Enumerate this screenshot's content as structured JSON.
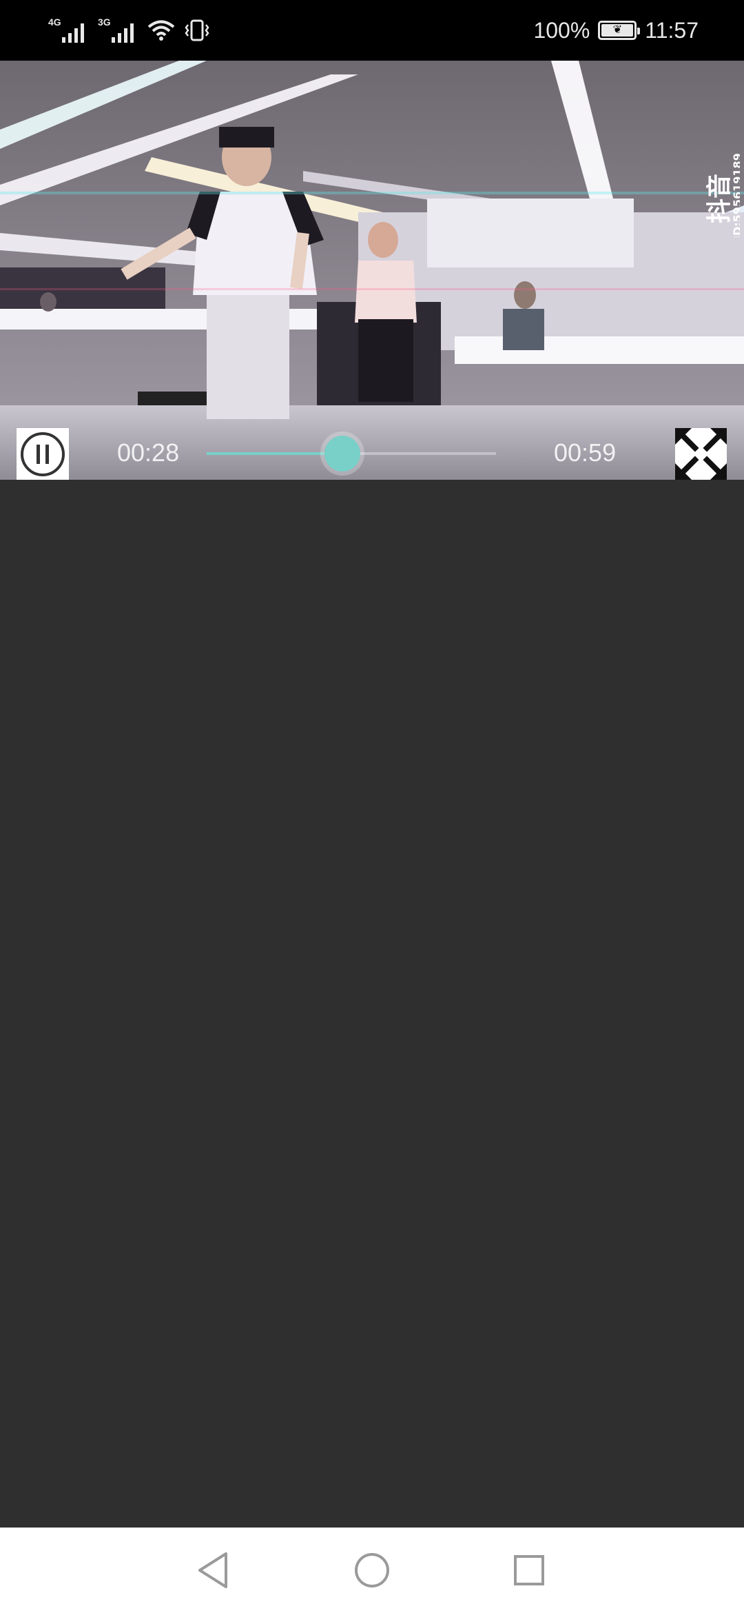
{
  "status_bar": {
    "network_1": "4G",
    "network_2": "3G",
    "battery_percent": "100%",
    "time": "11:57",
    "icons": [
      "signal-4g-icon",
      "signal-3g-icon",
      "wifi-icon",
      "vibrate-icon",
      "battery-icon"
    ]
  },
  "video": {
    "watermark_app": "抖音",
    "watermark_id": "ID:595619189",
    "current_time": "00:28",
    "total_time": "00:59",
    "progress_fraction": 0.47,
    "accent_color": "#78d0c8",
    "icons": [
      "pause-icon",
      "fullscreen-icon"
    ]
  },
  "nav_bar": {
    "icons": [
      "back-icon",
      "home-icon",
      "recents-icon"
    ]
  }
}
